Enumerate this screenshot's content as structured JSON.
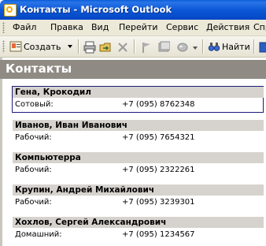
{
  "window": {
    "title": "Контакты - Microsoft Outlook"
  },
  "menu": [
    "Файл",
    "Правка",
    "Вид",
    "Перейти",
    "Сервис",
    "Действия",
    "Спр"
  ],
  "toolbar": {
    "create_label": "Создать",
    "find_label": "Найти"
  },
  "banner": {
    "title": "Контакты"
  },
  "contacts": [
    {
      "name": "Гена, Крокодил",
      "phone_type": "Сотовый:",
      "phone": "+7 (095) 8762348"
    },
    {
      "name": "Иванов, Иван Иванович",
      "phone_type": "Рабочий:",
      "phone": "+7 (095) 7654321"
    },
    {
      "name": "Компьютерра",
      "phone_type": "Рабочий:",
      "phone": "+7 (095) 2322261"
    },
    {
      "name": "Крупин, Андрей Михайлович",
      "phone_type": "Рабочий:",
      "phone": "+7 (095) 3239301"
    },
    {
      "name": "Хохлов, Сергей Александрович",
      "phone_type": "Домашний:",
      "phone": "+7 (095) 1234567"
    }
  ],
  "colors": {
    "titlebar": "#0b58d6",
    "menubar": "#ece9d8",
    "banner": "#8f8b84",
    "card_header": "#d6d3ce"
  }
}
